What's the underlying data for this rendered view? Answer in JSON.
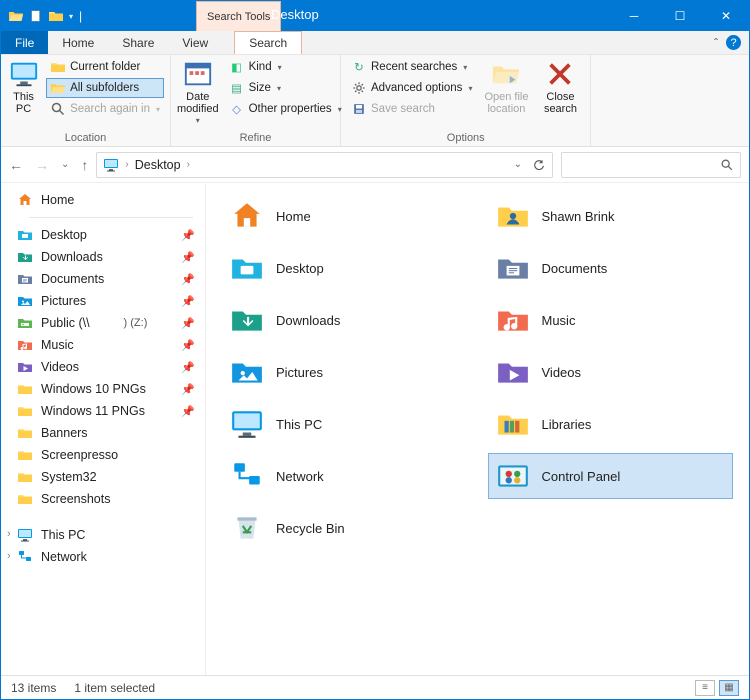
{
  "titlebar": {
    "tool_context": "Search Tools",
    "title": "Desktop"
  },
  "tabs": {
    "file": "File",
    "home": "Home",
    "share": "Share",
    "view": "View",
    "search": "Search"
  },
  "ribbon": {
    "location": {
      "this_pc": "This\nPC",
      "current_folder": "Current folder",
      "all_subfolders": "All subfolders",
      "search_again": "Search again in",
      "label": "Location"
    },
    "refine": {
      "date_modified": "Date\nmodified",
      "kind": "Kind",
      "size": "Size",
      "other": "Other properties",
      "label": "Refine"
    },
    "options": {
      "recent": "Recent searches",
      "advanced": "Advanced options",
      "save": "Save search",
      "open_loc": "Open file\nlocation",
      "close": "Close\nsearch",
      "label": "Options"
    }
  },
  "address": {
    "crumb": "Desktop"
  },
  "navpane": {
    "home": "Home",
    "quick": [
      {
        "label": "Desktop",
        "icon": "desktop",
        "pin": true
      },
      {
        "label": "Downloads",
        "icon": "downloads",
        "pin": true
      },
      {
        "label": "Documents",
        "icon": "documents",
        "pin": true
      },
      {
        "label": "Pictures",
        "icon": "pictures",
        "pin": true
      },
      {
        "label": "Public (\\\\",
        "icon": "netdrive",
        "pin": true,
        "drive": ") (Z:)"
      },
      {
        "label": "Music",
        "icon": "music",
        "pin": true
      },
      {
        "label": "Videos",
        "icon": "videos",
        "pin": true
      },
      {
        "label": "Windows 10 PNGs",
        "icon": "folder",
        "pin": true
      },
      {
        "label": "Windows 11 PNGs",
        "icon": "folder",
        "pin": true
      },
      {
        "label": "Banners",
        "icon": "folder",
        "pin": false
      },
      {
        "label": "Screenpresso",
        "icon": "folder",
        "pin": false
      },
      {
        "label": "System32",
        "icon": "folder",
        "pin": false
      },
      {
        "label": "Screenshots",
        "icon": "folder",
        "pin": false
      }
    ],
    "this_pc": "This PC",
    "network": "Network"
  },
  "items": [
    {
      "label": "Home",
      "icon": "home-lg"
    },
    {
      "label": "Shawn Brink",
      "icon": "user-folder"
    },
    {
      "label": "Desktop",
      "icon": "desktop-lg"
    },
    {
      "label": "Documents",
      "icon": "documents-lg"
    },
    {
      "label": "Downloads",
      "icon": "downloads-lg"
    },
    {
      "label": "Music",
      "icon": "music-lg"
    },
    {
      "label": "Pictures",
      "icon": "pictures-lg"
    },
    {
      "label": "Videos",
      "icon": "videos-lg"
    },
    {
      "label": "This PC",
      "icon": "monitor"
    },
    {
      "label": "Libraries",
      "icon": "libraries"
    },
    {
      "label": "Network",
      "icon": "network-lg"
    },
    {
      "label": "Control Panel",
      "icon": "control-panel",
      "selected": true
    },
    {
      "label": "Recycle Bin",
      "icon": "recycle"
    }
  ],
  "status": {
    "count": "13 items",
    "selection": "1 item selected"
  }
}
